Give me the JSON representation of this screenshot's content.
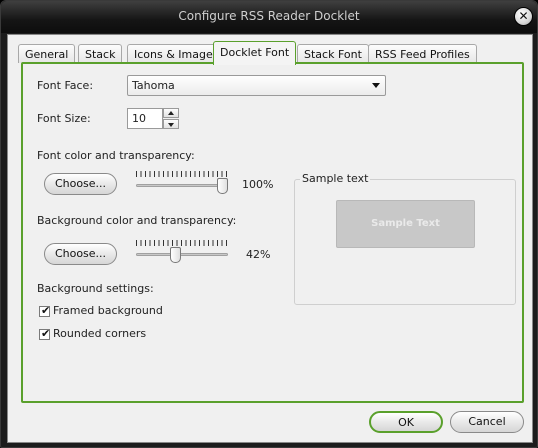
{
  "window": {
    "title": "Configure RSS Reader Docklet",
    "close_glyph": "✕"
  },
  "tabs": [
    {
      "label": "General"
    },
    {
      "label": "Stack"
    },
    {
      "label": "Icons & Images"
    },
    {
      "label": "Docklet Font"
    },
    {
      "label": "Stack Font"
    },
    {
      "label": "RSS Feed Profiles"
    }
  ],
  "active_tab": "Docklet Font",
  "font_face": {
    "label": "Font Face:",
    "value": "Tahoma"
  },
  "font_size": {
    "label": "Font Size:",
    "value": "10"
  },
  "font_color": {
    "label": "Font color and transparency:",
    "button_label": "Choose...",
    "transparency_value": 100,
    "transparency_text": "100%"
  },
  "background_color": {
    "label": "Background color and transparency:",
    "button_label": "Choose...",
    "transparency_value": 42,
    "transparency_text": "42%"
  },
  "sample": {
    "group_label": "Sample text",
    "text": "Sample Text"
  },
  "background_settings": {
    "label": "Background settings:",
    "framed": {
      "label": "Framed background",
      "checked": true
    },
    "rounded": {
      "label": "Rounded corners",
      "checked": true
    }
  },
  "footer": {
    "ok_label": "OK",
    "cancel_label": "Cancel"
  },
  "colors": {
    "accent": "#5aa02c",
    "sample_bg": "#c8c8c8"
  },
  "icons": {
    "check": "✔",
    "dropdown": "chevron-down-icon"
  }
}
